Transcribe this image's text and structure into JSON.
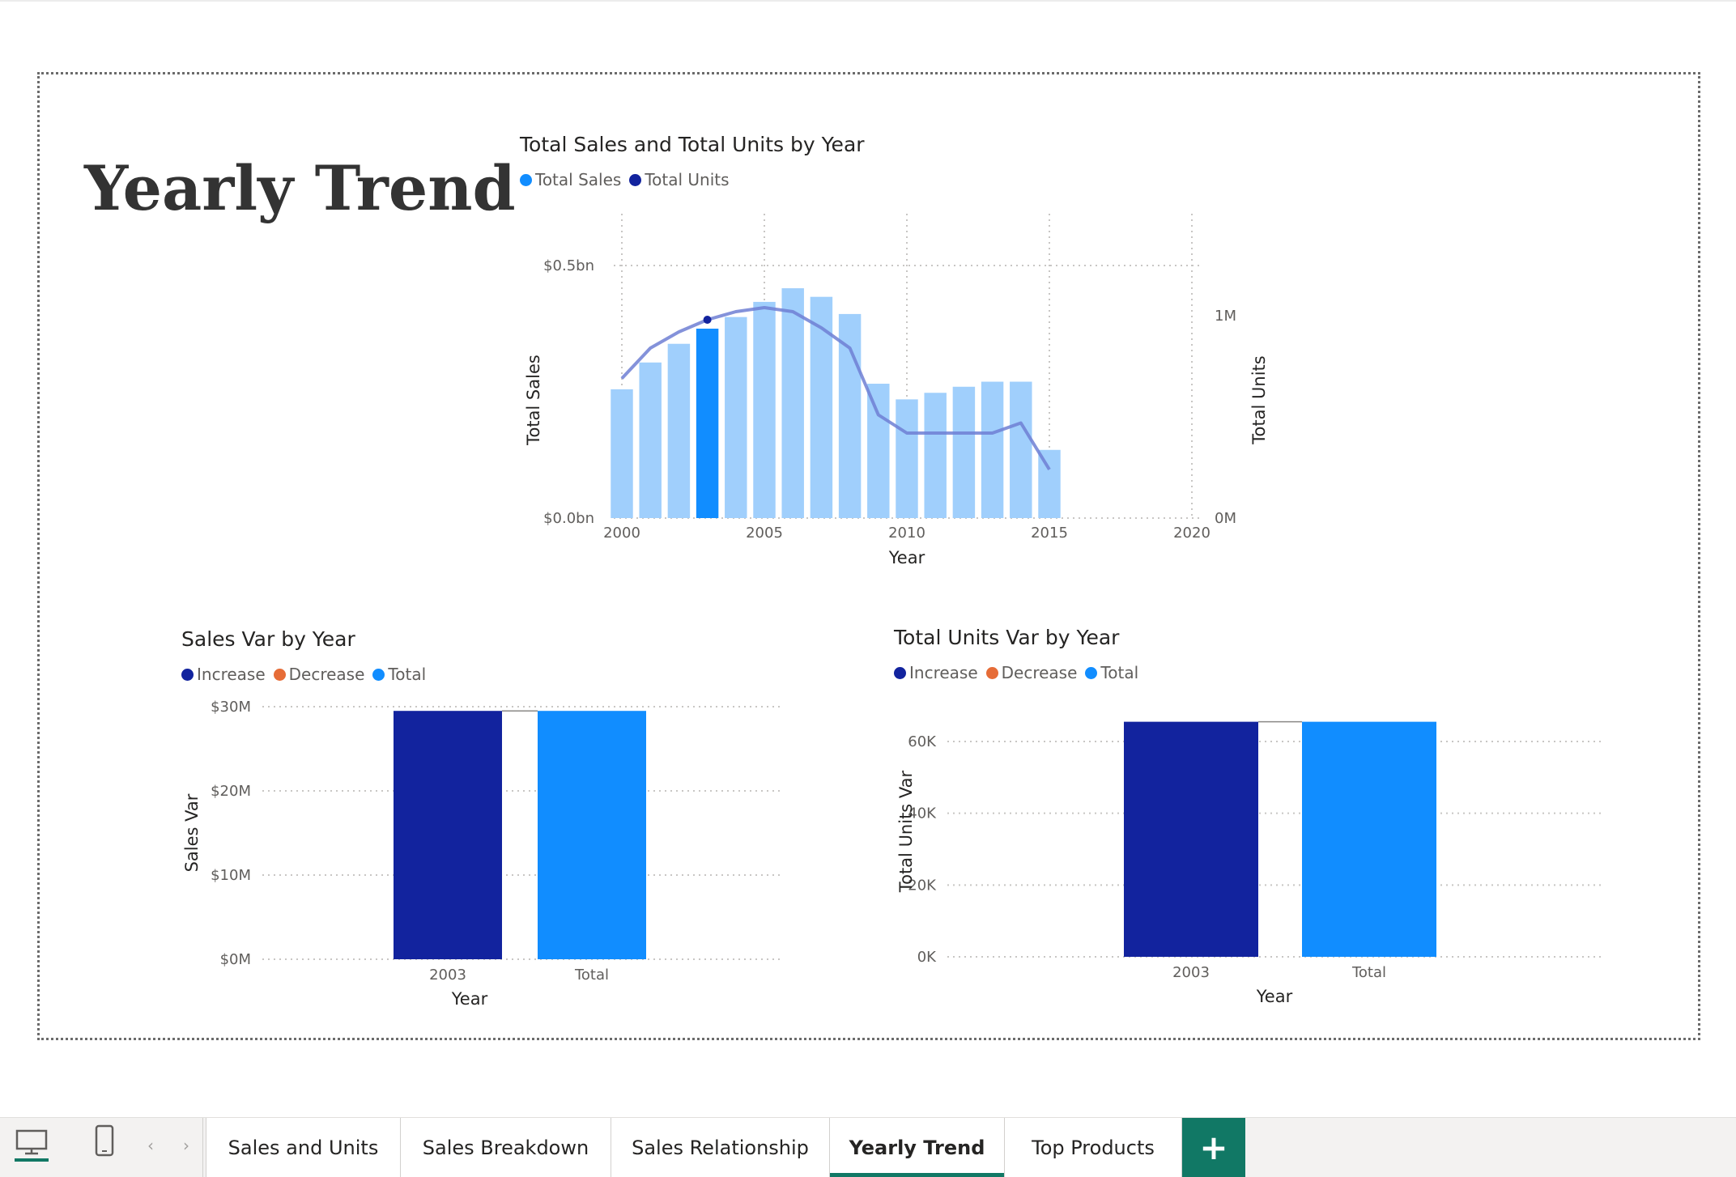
{
  "page": {
    "title": "Yearly Trend"
  },
  "colors": {
    "total_sales_bar": "#a0cffc",
    "total_sales_highlight": "#118dff",
    "total_units_line": "#6f7fd4",
    "increase": "#12239e",
    "decrease": "#e66c37",
    "total": "#118dff"
  },
  "charts": {
    "combo": {
      "title": "Total Sales and Total Units by Year",
      "legend": [
        {
          "label": "Total Sales",
          "color": "#118dff"
        },
        {
          "label": "Total Units",
          "color": "#12239e"
        }
      ],
      "ylabel": "Total Sales",
      "y2label": "Total Units",
      "xlabel": "Year",
      "y_ticks": [
        "$0.0bn",
        "$0.5bn"
      ],
      "y2_ticks": [
        "0M",
        "1M"
      ],
      "x_ticks": [
        "2000",
        "2005",
        "2010",
        "2015",
        "2020"
      ]
    },
    "sales_var": {
      "title": "Sales Var by Year",
      "legend": [
        {
          "label": "Increase",
          "color": "#12239e"
        },
        {
          "label": "Decrease",
          "color": "#e66c37"
        },
        {
          "label": "Total",
          "color": "#118dff"
        }
      ],
      "ylabel": "Sales Var",
      "xlabel": "Year",
      "y_ticks": [
        "$0M",
        "$10M",
        "$20M",
        "$30M"
      ],
      "categories": [
        "2003",
        "Total"
      ]
    },
    "units_var": {
      "title": "Total Units Var by Year",
      "legend": [
        {
          "label": "Increase",
          "color": "#12239e"
        },
        {
          "label": "Decrease",
          "color": "#e66c37"
        },
        {
          "label": "Total",
          "color": "#118dff"
        }
      ],
      "ylabel": "Total Units Var",
      "xlabel": "Year",
      "y_ticks": [
        "0K",
        "20K",
        "40K",
        "60K"
      ],
      "categories": [
        "2003",
        "Total"
      ]
    }
  },
  "chart_data": [
    {
      "type": "bar",
      "title": "Total Sales and Total Units by Year",
      "xlabel": "Year",
      "ylabel": "Total Sales",
      "y2label": "Total Units",
      "x": [
        2000,
        2001,
        2002,
        2003,
        2004,
        2005,
        2006,
        2007,
        2008,
        2009,
        2010,
        2011,
        2012,
        2013,
        2014,
        2015
      ],
      "xlim": [
        2000,
        2020
      ],
      "ylim": [
        0,
        0.5
      ],
      "y2lim": [
        0,
        1.0
      ],
      "series": [
        {
          "name": "Total Sales",
          "type": "bar",
          "unit": "bn",
          "highlight_x": 2003,
          "values": [
            0.255,
            0.308,
            0.345,
            0.375,
            0.398,
            0.428,
            0.455,
            0.438,
            0.404,
            0.266,
            0.235,
            0.248,
            0.26,
            0.27,
            0.27,
            0.135
          ]
        },
        {
          "name": "Total Units",
          "type": "line",
          "unit": "M",
          "values": [
            0.69,
            0.84,
            0.92,
            0.98,
            1.02,
            1.04,
            1.02,
            0.94,
            0.84,
            0.51,
            0.42,
            0.42,
            0.42,
            0.42,
            0.47,
            0.24
          ]
        }
      ],
      "grid": true,
      "legend": "top-left"
    },
    {
      "type": "bar",
      "title": "Sales Var by Year",
      "xlabel": "Year",
      "ylabel": "Sales Var",
      "categories": [
        "2003",
        "Total"
      ],
      "series": [
        {
          "name": "Increase",
          "values": [
            29.5,
            null
          ]
        },
        {
          "name": "Total",
          "values": [
            null,
            29.5
          ]
        }
      ],
      "ylim": [
        0,
        30
      ],
      "grid": true,
      "legend": "top-left"
    },
    {
      "type": "bar",
      "title": "Total Units Var by Year",
      "xlabel": "Year",
      "ylabel": "Total Units Var",
      "categories": [
        "2003",
        "Total"
      ],
      "series": [
        {
          "name": "Increase",
          "values": [
            65.5,
            null
          ]
        },
        {
          "name": "Total",
          "values": [
            null,
            65.5
          ]
        }
      ],
      "ylim": [
        0,
        60
      ],
      "grid": true,
      "legend": "top-left"
    }
  ],
  "tabbar": {
    "device_icons": [
      "desktop-icon",
      "phone-icon"
    ],
    "nav_prev": "‹",
    "nav_next": "›",
    "tabs": [
      {
        "label": "Sales and Units",
        "active": false
      },
      {
        "label": "Sales Breakdown",
        "active": false
      },
      {
        "label": "Sales Relationship",
        "active": false
      },
      {
        "label": "Yearly Trend",
        "active": true
      },
      {
        "label": "Top Products",
        "active": false
      }
    ],
    "add_label": "+"
  }
}
